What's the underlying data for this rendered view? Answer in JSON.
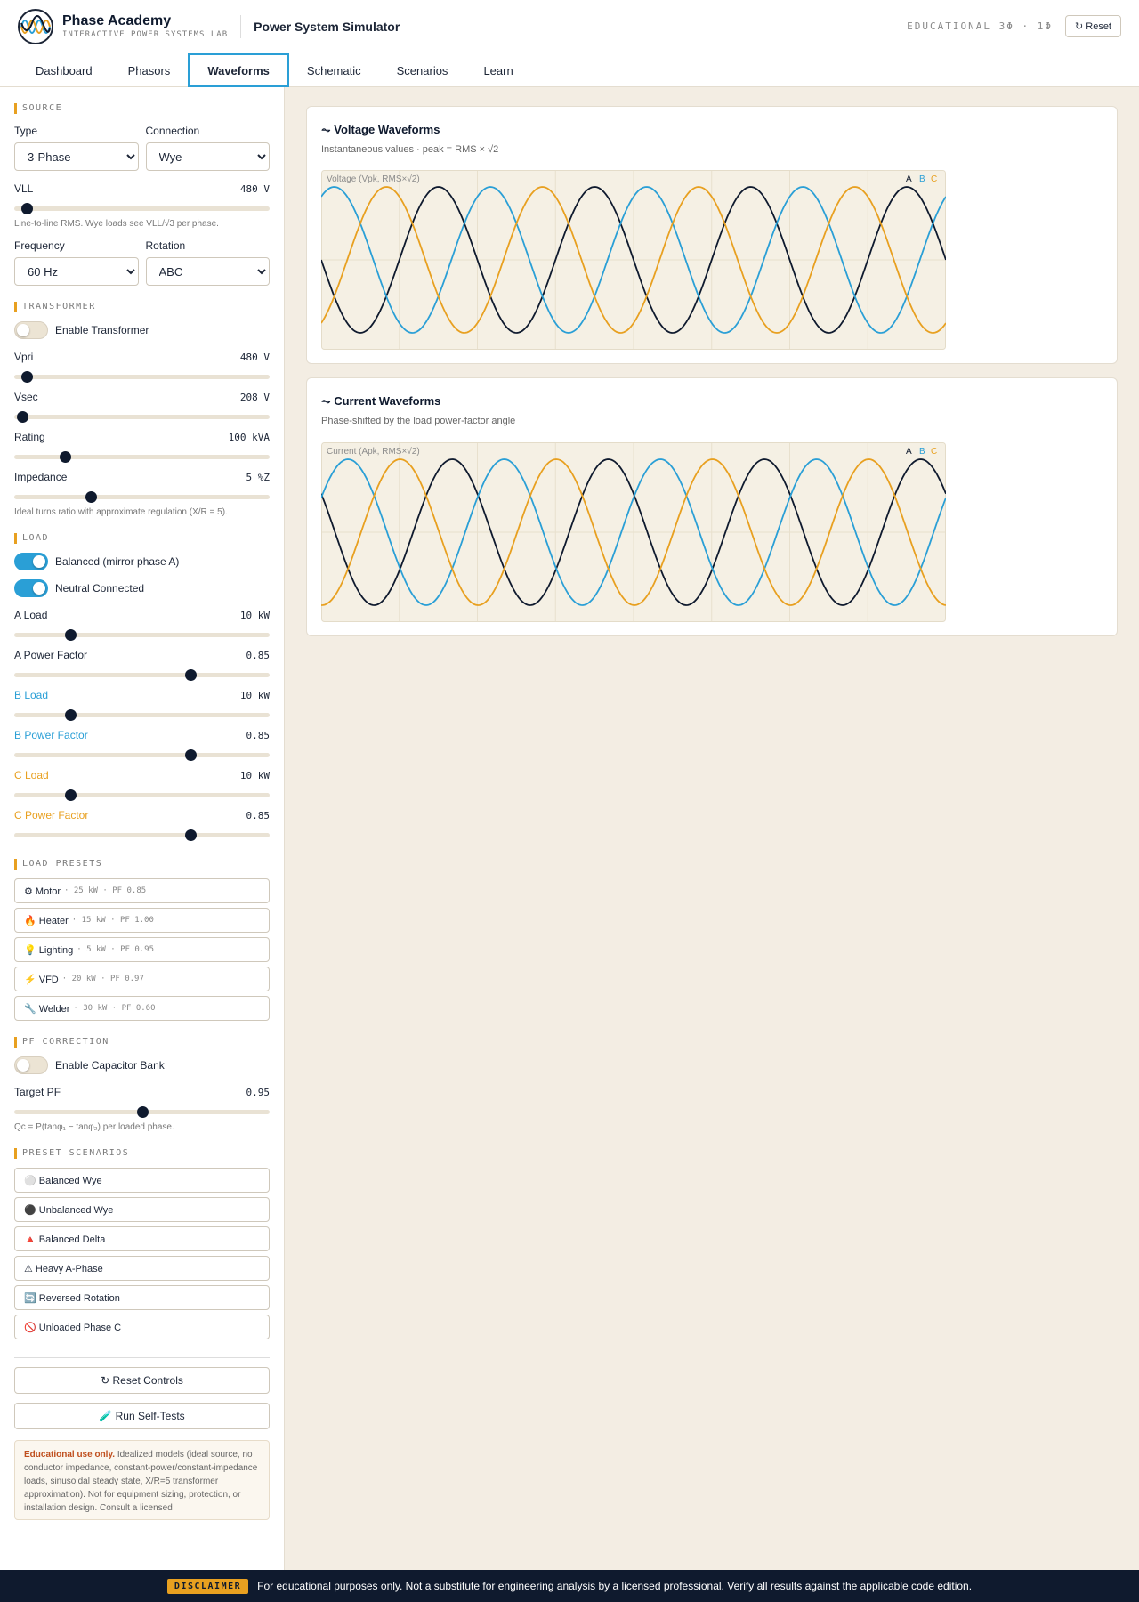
{
  "header": {
    "brand": "Phase Academy",
    "tagline": "INTERACTIVE POWER SYSTEMS LAB",
    "app_title": "Power System Simulator",
    "edition": "EDUCATIONAL 3Φ · 1Φ",
    "reset": "↻ Reset"
  },
  "tabs": [
    "Dashboard",
    "Phasors",
    "Waveforms",
    "Schematic",
    "Scenarios",
    "Learn"
  ],
  "source": {
    "section": "SOURCE",
    "type_label": "Type",
    "type_value": "3-Phase",
    "connection_label": "Connection",
    "connection_value": "Wye",
    "vll_label": "VLL",
    "vll_value": "480 V",
    "vll_level": 0.05,
    "vll_hint": "Line-to-line RMS. Wye loads see VLL/√3 per phase.",
    "freq_label": "Frequency",
    "freq_value": "60 Hz",
    "rotation_label": "Rotation",
    "rotation_value": "ABC"
  },
  "transformer": {
    "section": "TRANSFORMER",
    "enable_label": "Enable Transformer",
    "enabled": false,
    "vpri_label": "Vpri",
    "vpri_value": "480 V",
    "vpri_level": 0.05,
    "vsec_label": "Vsec",
    "vsec_value": "208 V",
    "vsec_level": 0.03,
    "rating_label": "Rating",
    "rating_value": "100 kVA",
    "rating_level": 0.2,
    "imp_label": "Impedance",
    "imp_value": "5 %Z",
    "imp_level": 0.3,
    "hint": "Ideal turns ratio with approximate regulation (X/R = 5)."
  },
  "load": {
    "section": "LOAD",
    "balanced_label": "Balanced (mirror phase A)",
    "neutral_label": "Neutral Connected",
    "a_load_label": "A Load",
    "a_load_value": "10 kW",
    "a_load_level": 0.22,
    "a_pf_label": "A Power Factor",
    "a_pf_value": "0.85",
    "a_pf_level": 0.69,
    "b_load_label": "B Load",
    "b_load_value": "10 kW",
    "b_load_level": 0.22,
    "b_pf_label": "B Power Factor",
    "b_pf_value": "0.85",
    "b_pf_level": 0.69,
    "c_load_label": "C Load",
    "c_load_value": "10 kW",
    "c_load_level": 0.22,
    "c_pf_label": "C Power Factor",
    "c_pf_value": "0.85",
    "c_pf_level": 0.69
  },
  "presets": {
    "section": "LOAD PRESETS",
    "items": [
      {
        "name": "⚙ Motor",
        "desc": "· 25 kW · PF 0.85"
      },
      {
        "name": "🔥 Heater",
        "desc": "· 15 kW · PF 1.00"
      },
      {
        "name": "💡 Lighting",
        "desc": "· 5 kW · PF 0.95"
      },
      {
        "name": "⚡ VFD",
        "desc": "· 20 kW · PF 0.97"
      },
      {
        "name": "🔧 Welder",
        "desc": "· 30 kW · PF 0.60"
      }
    ]
  },
  "pfc": {
    "section": "PF CORRECTION",
    "enable_label": "Enable Capacitor Bank",
    "target_label": "Target PF",
    "target_value": "0.95",
    "target_level": 0.5,
    "hint": "Qc = P(tanφ₁ − tanφ₂) per loaded phase."
  },
  "scenarios": {
    "section": "PRESET SCENARIOS",
    "items": [
      "⚪ Balanced Wye",
      "⚫ Unbalanced Wye",
      "🔺 Balanced Delta",
      "⚠ Heavy A-Phase",
      "🔄 Reversed Rotation",
      "🚫 Unloaded Phase C"
    ]
  },
  "actions": {
    "reset_controls": "↻ Reset Controls",
    "self_tests": "🧪 Run Self-Tests"
  },
  "note": {
    "bold": "Educational use only.",
    "text": "Idealized models (ideal source, no conductor impedance, constant-power/constant-impedance loads, sinusoidal steady state, X/R=5 transformer approximation). Not for equipment sizing, protection, or installation design. Consult a licensed"
  },
  "voltage_card": {
    "title": "⏦ Voltage Waveforms",
    "subtitle": "Instantaneous values · peak = RMS × √2",
    "plot_label": "Voltage (Vpk, RMS×√2)"
  },
  "current_card": {
    "title": "⏦ Current Waveforms",
    "subtitle": "Phase-shifted by the load power-factor angle",
    "plot_label": "Current (Apk, RMS×√2)"
  },
  "legend": [
    "A",
    "B",
    "C"
  ],
  "colors": {
    "A": "#0f1a2e",
    "B": "#2a9fd6",
    "C": "#e8a020",
    "accent": "#e8a020"
  },
  "footer": {
    "badge": "DISCLAIMER",
    "text": "For educational purposes only. Not a substitute for engineering analysis by a licensed professional. Verify all results against the applicable code edition."
  },
  "chart_data": [
    {
      "type": "line",
      "plot": "voltage",
      "cycles": 4,
      "series": [
        {
          "name": "A",
          "phase_deg": 0
        },
        {
          "name": "B",
          "phase_deg": -120
        },
        {
          "name": "C",
          "phase_deg": 120
        }
      ]
    },
    {
      "type": "line",
      "plot": "current",
      "cycles": 4,
      "series": [
        {
          "name": "A",
          "phase_deg": -31.8
        },
        {
          "name": "B",
          "phase_deg": -151.8
        },
        {
          "name": "C",
          "phase_deg": 88.2
        }
      ]
    }
  ]
}
